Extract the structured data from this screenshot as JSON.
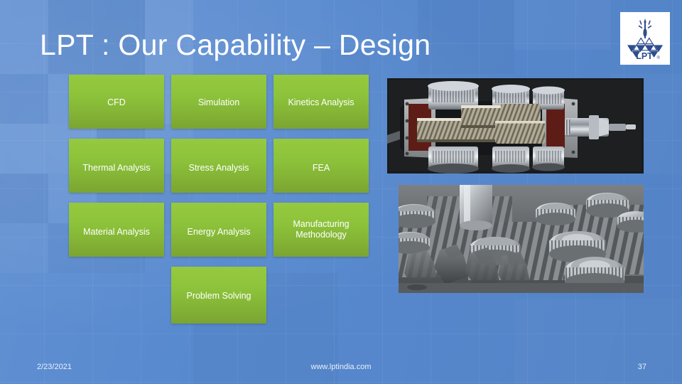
{
  "slide": {
    "title": "LPT : Our Capability – Design",
    "background_color": "#5789cf",
    "accent_green": "#8dc63f"
  },
  "logo": {
    "name": "lpt-logo",
    "wordmark": "LPT",
    "registered_mark": "®",
    "color": "#2e4d8e"
  },
  "capabilities": [
    {
      "label": "CFD"
    },
    {
      "label": "Simulation"
    },
    {
      "label": "Kinetics Analysis"
    },
    {
      "label": "Thermal Analysis"
    },
    {
      "label": "Stress Analysis"
    },
    {
      "label": "FEA"
    },
    {
      "label": "Material Analysis"
    },
    {
      "label": "Energy Analysis"
    },
    {
      "label": "Manufacturing Methodology"
    },
    {
      "label": "Problem Solving"
    }
  ],
  "photos": [
    {
      "name": "gearbox-cutaway-photo"
    },
    {
      "name": "gears-and-bearings-photo"
    }
  ],
  "footer": {
    "date": "2/23/2021",
    "website": "www.lptindia.com",
    "page_number": "37"
  }
}
